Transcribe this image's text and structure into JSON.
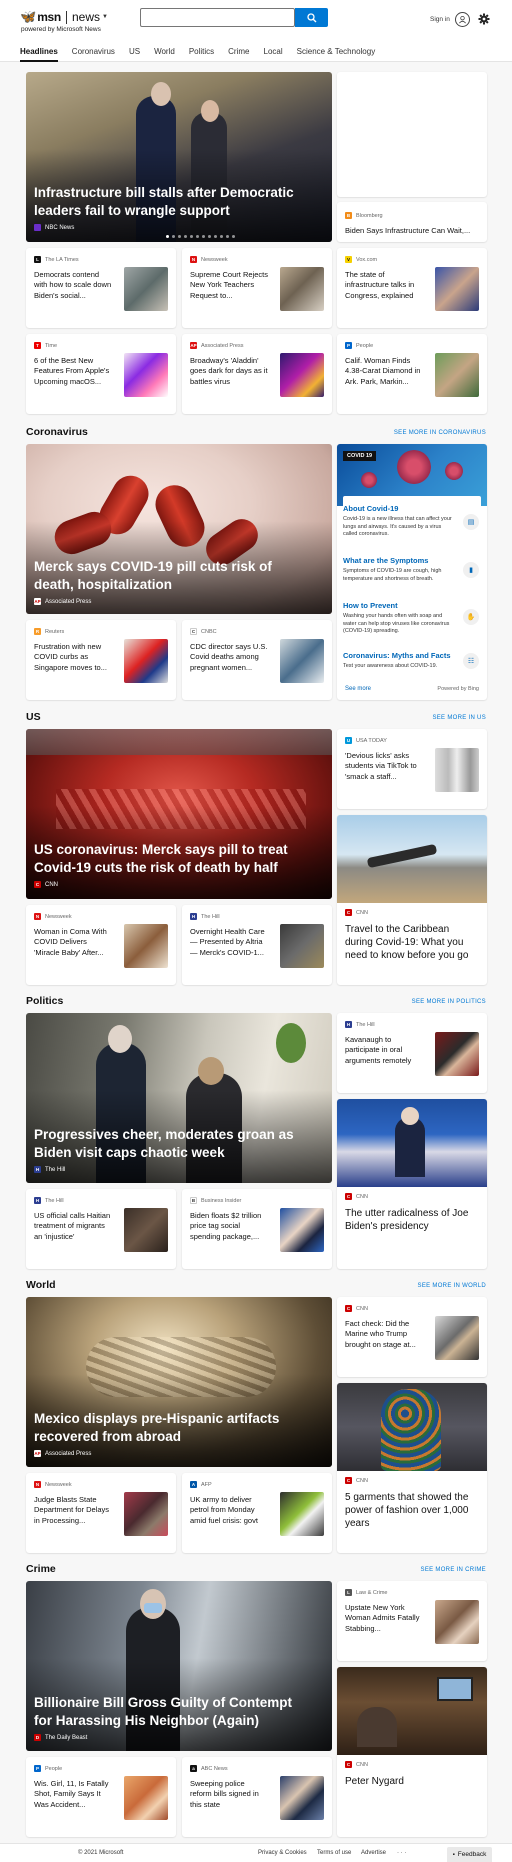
{
  "header": {
    "brand": "msn",
    "product": "news",
    "powered_by": "powered by Microsoft News",
    "search_value": "",
    "signin": "Sign in"
  },
  "nav": [
    "Headlines",
    "Coronavirus",
    "US",
    "World",
    "Politics",
    "Crime",
    "Local",
    "Science & Technology"
  ],
  "headlines": {
    "hero": {
      "title": "Infrastructure bill stalls after Democratic leaders fail to wrangle support",
      "source": "NBC News"
    },
    "side_top": {
      "source": "Bloomberg",
      "title": "Biden Says Infrastructure Can Wait,..."
    },
    "row1": [
      {
        "source": "The LA Times",
        "title": "Democrats contend with how to scale down Biden's social..."
      },
      {
        "source": "Newsweek",
        "title": "Supreme Court Rejects New York Teachers Request to..."
      },
      {
        "source": "Vox.com",
        "title": "The state of infrastructure talks in Congress, explained"
      }
    ],
    "row2": [
      {
        "source": "Time",
        "title": "6 of the Best New Features From Apple's Upcoming macOS..."
      },
      {
        "source": "Associated Press",
        "title": "Broadway's 'Aladdin' goes dark for days as it battles virus"
      },
      {
        "source": "People",
        "title": "Calif. Woman Finds 4.38-Carat Diamond in Ark. Park, Markin..."
      }
    ]
  },
  "coronavirus": {
    "section": "Coronavirus",
    "see_more": "SEE MORE IN CORONAVIRUS",
    "hero": {
      "title": "Merck says COVID-19 pill cuts risk of death, hospitalization",
      "source": "Associated Press"
    },
    "small": [
      {
        "source": "Reuters",
        "title": "Frustration with new COVID curbs as Singapore moves to..."
      },
      {
        "source": "CNBC",
        "title": "CDC director says U.S. Covid deaths among pregnant women..."
      }
    ],
    "info": {
      "tag": "COVID 19",
      "items": [
        {
          "title": "About Covid-19",
          "desc": "Covid-19 is a new illness that can affect your lungs and airways. It's caused by a virus called coronavirus."
        },
        {
          "title": "What are the Symptoms",
          "desc": "Symptoms of COVID-19 are cough, high temperature and shortness of breath."
        },
        {
          "title": "How to Prevent",
          "desc": "Washing your hands often with soap and water can help stop viruses like coronavirus (COVID-19) spreading."
        },
        {
          "title": "Coronavirus: Myths and Facts",
          "desc": "Test your awareness about COVID-19."
        }
      ],
      "see_more": "See more",
      "powered": "Powered by Bing"
    }
  },
  "us": {
    "section": "US",
    "see_more": "SEE MORE IN US",
    "hero": {
      "title": "US coronavirus: Merck says pill to treat Covid-19 cuts the risk of death by half",
      "source": "CNN"
    },
    "side_top": {
      "source": "USA TODAY",
      "title": "'Devious licks' asks students via TikTok to 'smack a staff..."
    },
    "side_big": {
      "source": "CNN",
      "title": "Travel to the Caribbean during Covid-19: What you need to know before you go"
    },
    "small": [
      {
        "source": "Newsweek",
        "title": "Woman in Coma With COVID Delivers 'Miracle Baby' After..."
      },
      {
        "source": "The Hill",
        "title": "Overnight Health Care — Presented by Altria — Merck's COVID-1..."
      }
    ]
  },
  "politics": {
    "section": "Politics",
    "see_more": "SEE MORE IN POLITICS",
    "hero": {
      "title": "Progressives cheer, moderates groan as Biden visit caps chaotic week",
      "source": "The Hill"
    },
    "side_top": {
      "source": "The Hill",
      "title": "Kavanaugh to participate in oral arguments remotely"
    },
    "side_big": {
      "source": "CNN",
      "title": "The utter radicalness of Joe Biden's presidency"
    },
    "small": [
      {
        "source": "The Hill",
        "title": "US official calls Haitian treatment of migrants an 'injustice'"
      },
      {
        "source": "Business Insider",
        "title": "Biden floats $2 trillion price tag social spending package,..."
      }
    ]
  },
  "world": {
    "section": "World",
    "see_more": "SEE MORE IN WORLD",
    "hero": {
      "title": "Mexico displays pre-Hispanic artifacts recovered from abroad",
      "source": "Associated Press"
    },
    "side_top": {
      "source": "CNN",
      "title": "Fact check: Did the Marine who Trump brought on stage at..."
    },
    "side_big": {
      "source": "CNN",
      "title": "5 garments that showed the power of fashion over 1,000 years"
    },
    "small": [
      {
        "source": "Newsweek",
        "title": "Judge Blasts State Department for Delays in Processing..."
      },
      {
        "source": "AFP",
        "title": "UK army to deliver petrol from Monday amid fuel crisis: govt"
      }
    ]
  },
  "crime": {
    "section": "Crime",
    "see_more": "SEE MORE IN CRIME",
    "hero": {
      "title": "Billionaire Bill Gross Guilty of Contempt for Harassing His Neighbor (Again)",
      "source": "The Daily Beast"
    },
    "side_top": {
      "source": "Law & Crime",
      "title": "Upstate New York Woman Admits Fatally Stabbing..."
    },
    "side_big": {
      "source": "CNN",
      "title": "Peter Nygard"
    },
    "small": [
      {
        "source": "People",
        "title": "Wis. Girl, 11, Is Fatally Shot, Family Says It Was Accident..."
      },
      {
        "source": "ABC News",
        "title": "Sweeping police reform bills signed in this state"
      }
    ]
  },
  "footer": {
    "copyright": "© 2021 Microsoft",
    "privacy": "Privacy & Cookies",
    "terms": "Terms of use",
    "advertise": "Advertise",
    "more": "· · ·",
    "feedback": "Feedback"
  },
  "colors": {
    "accent": "#0078d4",
    "link": "#0067b8",
    "cnn": "#cc0000"
  }
}
